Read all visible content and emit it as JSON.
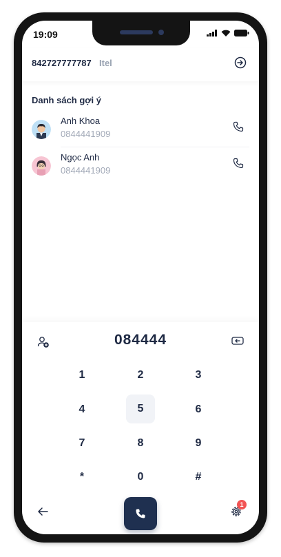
{
  "status_bar": {
    "time": "19:09"
  },
  "header": {
    "phone_number": "842727777787",
    "carrier": "Itel"
  },
  "suggestions": {
    "title": "Danh sách gợi ý",
    "contacts": [
      {
        "name": "Anh Khoa",
        "number": "0844441909",
        "avatar": "male-avatar"
      },
      {
        "name": "Ngọc Anh",
        "number": "0844441909",
        "avatar": "female-avatar"
      }
    ]
  },
  "dialer": {
    "current_number": "084444",
    "keys": [
      "1",
      "2",
      "3",
      "4",
      "5",
      "6",
      "7",
      "8",
      "9",
      "*",
      "0",
      "#"
    ],
    "active_key": "5"
  },
  "settings": {
    "badge_count": "1"
  },
  "colors": {
    "primary": "#1f3050",
    "badge": "#f25454",
    "muted": "#a3aab8"
  }
}
